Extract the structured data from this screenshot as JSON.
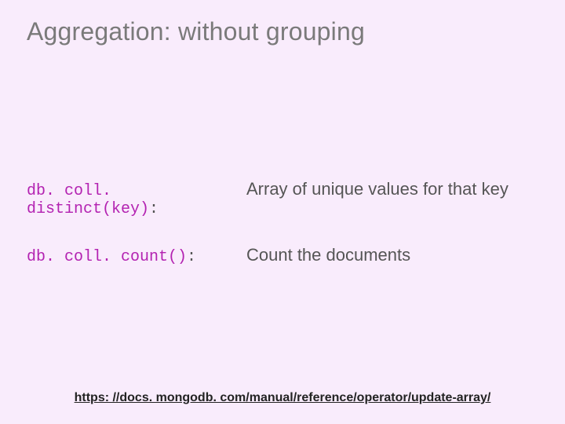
{
  "title": "Aggregation: without grouping",
  "rows": [
    {
      "code": "db. coll. distinct(key)",
      "trail": ":",
      "desc": "Array of unique values for that key"
    },
    {
      "code": "db. coll. count()",
      "trail": ":",
      "desc": "Count the documents"
    }
  ],
  "link": {
    "text": "https: //docs. mongodb. com/manual/reference/operator/update-array/",
    "href": "https://docs.mongodb.com/manual/reference/operator/update-array/"
  }
}
